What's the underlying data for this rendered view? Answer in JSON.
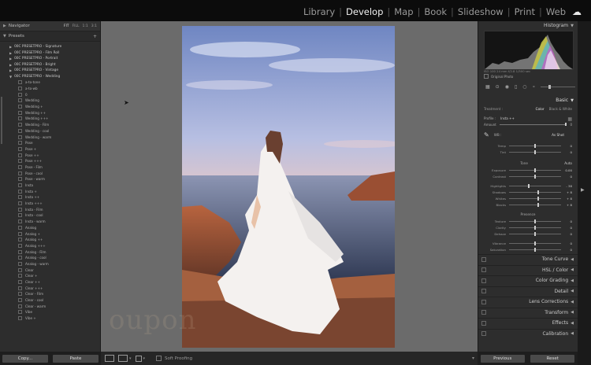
{
  "modules": {
    "items": [
      "Library",
      "Develop",
      "Map",
      "Book",
      "Slideshow",
      "Print",
      "Web"
    ],
    "active": "Develop",
    "cloud_icon": "cloud-icon"
  },
  "left_panel": {
    "navigator_label": "Navigator",
    "navigator_options": [
      "FIT",
      "FILL",
      "1:1",
      "3:1"
    ],
    "presets_label": "Presets",
    "groups": [
      "00C PRESETPRO - Signature",
      "00C PRESETPRO - Film Roll",
      "00C PRESETPRO - Portrait",
      "00C PRESETPRO - Bright",
      "00C PRESETPRO - Vintage",
      "00C PRESETPRO - Wedding"
    ],
    "presets": [
      "a-to-tone",
      "a-to-wb",
      "0",
      "Wedding",
      "Wedding +",
      "Wedding ++",
      "Wedding +++",
      "Wedding - Film",
      "Wedding - cool",
      "Wedding - warm",
      "Pose",
      "Pose +",
      "Pose ++",
      "Pose +++",
      "Pose - Film",
      "Pose - cool",
      "Pose - warm",
      "Insta",
      "Insta +",
      "Insta ++",
      "Insta +++",
      "Insta - Film",
      "Insta - cool",
      "Insta - warm",
      "Analog",
      "Analog +",
      "Analog ++",
      "Analog +++",
      "Analog - Film",
      "Analog - cool",
      "Analog - warm",
      "Clear",
      "Clear +",
      "Clear ++",
      "Clear +++",
      "Clear - Film",
      "Clear - cool",
      "Clear - warm",
      "Vibe",
      "Vibe +"
    ],
    "copy_label": "Copy...",
    "paste_label": "Paste"
  },
  "watermark_text": "oupon",
  "toolbar": {
    "soft_proofing_label": "Soft Proofing"
  },
  "right_panel": {
    "histogram_label": "Histogram",
    "histogram_meta": "ISO 100   24 mm   f/2.8   1/500 sec",
    "original_photo_label": "Original Photo",
    "basic_label": "Basic",
    "treatment_label": "Treatment :",
    "treatment_color": "Color",
    "treatment_bw": "Black & White",
    "profile_label": "Profile :",
    "profile_value": "Insta ++",
    "amount_label": "Amount",
    "amount_value": "0",
    "wb_label": "WB :",
    "wb_value": "As Shot",
    "temp_label": "Temp",
    "temp_value": "0",
    "tint_label": "Tint",
    "tint_value": "0",
    "tone_label": "Tone",
    "auto_label": "Auto",
    "exposure_label": "Exposure",
    "exposure_value": "0.00",
    "contrast_label": "Contrast",
    "contrast_value": "0",
    "highlights_label": "Highlights",
    "highlights_value": "- 38",
    "shadows_label": "Shadows",
    "shadows_value": "+ 8",
    "whites_label": "Whites",
    "whites_value": "+ 8",
    "blacks_label": "Blacks",
    "blacks_value": "+ 8",
    "presence_label": "Presence",
    "texture_label": "Texture",
    "texture_value": "0",
    "clarity_label": "Clarity",
    "clarity_value": "0",
    "dehaze_label": "Dehaze",
    "dehaze_value": "0",
    "vibrance_label": "Vibrance",
    "vibrance_value": "0",
    "saturation_label": "Saturation",
    "saturation_value": "0",
    "sliders": {
      "temp": 0.5,
      "tint": 0.5,
      "exposure": 0.5,
      "contrast": 0.5,
      "highlights": 0.38,
      "shadows": 0.56,
      "whites": 0.56,
      "blacks": 0.56,
      "texture": 0.5,
      "clarity": 0.5,
      "dehaze": 0.5,
      "vibrance": 0.5,
      "saturation": 0.5
    },
    "collapsed_panels": [
      "Tone Curve",
      "HSL / Color",
      "Color Grading",
      "Detail",
      "Lens Corrections",
      "Transform",
      "Effects",
      "Calibration"
    ],
    "previous_label": "Previous",
    "reset_label": "Reset"
  }
}
